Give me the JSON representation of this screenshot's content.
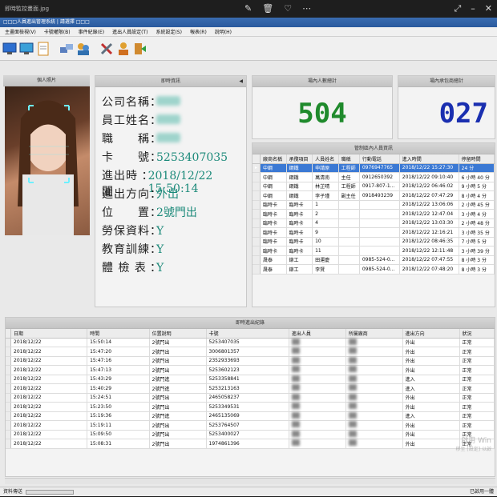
{
  "viewer": {
    "filename": "即時監控畫面.jpg",
    "icons": [
      "edit-icon",
      "trash-icon",
      "heart-icon",
      "more-icon"
    ],
    "right_icons": [
      "expand-icon",
      "minimize-icon",
      "close-icon"
    ]
  },
  "app": {
    "title": "□□□人員進出管理系統 | 請選擇 □□□ ",
    "menu": [
      "主畫面檢視(V)",
      "卡號權限(B)",
      "事件紀錄(E)",
      "進出人員設定(T)",
      "系統設定(S)",
      "報表(R)",
      "說明(H)"
    ]
  },
  "toolbar": {
    "buttons": [
      "monitor-icon",
      "monitor-icon",
      "document-icon",
      "network-icon",
      "users-icon",
      "tools-icon",
      "user-settings-icon",
      "exit-icon"
    ]
  },
  "photo_panel": {
    "title": "個人照片"
  },
  "info_panel": {
    "title": "即時資訊",
    "rows": [
      {
        "label": "公司名稱",
        "value": ""
      },
      {
        "label": "員工姓名",
        "value": ""
      },
      {
        "label": "職　　稱",
        "value": ""
      },
      {
        "label": "卡　　號",
        "value": "5253407035"
      },
      {
        "label": "進出時間",
        "value": "2018/12/22 15:50:14"
      },
      {
        "label": "進出方向",
        "value": "外出"
      },
      {
        "label": "位　　置",
        "value": "2號門出"
      },
      {
        "label": "勞保資料",
        "value": "Y"
      },
      {
        "label": "教育訓練",
        "value": "Y"
      },
      {
        "label": "體 檢 表",
        "value": "Y"
      }
    ]
  },
  "stat_left": {
    "title": "場內人數總計",
    "value": "504",
    "color": "#1f8a2c"
  },
  "stat_right": {
    "title": "場內承包商總計",
    "value": "027",
    "color": "#1a2fb0"
  },
  "present_panel": {
    "title": "管制區內人員資訊",
    "columns": [
      "廠商名稱",
      "承攬項目",
      "人員姓名",
      "職稱",
      "行動電話",
      "進入時間",
      "停留時間"
    ],
    "rows": [
      [
        "中鋼",
        "鋼鐵",
        "申請原",
        "工程師",
        "0976947765",
        "2018/12/22 15:27:30",
        "24 分"
      ],
      [
        "中鋼",
        "鋼鐵",
        "萬清南",
        "主任",
        "0912650392",
        "2018/12/22 09:10:40",
        "6 小時 40 分"
      ],
      [
        "中鋼",
        "鋼鐵",
        "林芷晴",
        "工程師",
        "0917-807-1...",
        "2018/12/22 06:46:02",
        "9 小時 5 分"
      ],
      [
        "中鋼",
        "鋼鐵",
        "李子瑾",
        "副主任",
        "0918493239",
        "2018/12/22 07:47:29",
        "8 小時 4 分"
      ],
      [
        "臨時卡",
        "臨時卡",
        "1",
        "",
        "",
        "2018/12/22 13:06:06",
        "2 小時 45 分"
      ],
      [
        "臨時卡",
        "臨時卡",
        "2",
        "",
        "",
        "2018/12/22 12:47:04",
        "3 小時 4 分"
      ],
      [
        "臨時卡",
        "臨時卡",
        "4",
        "",
        "",
        "2018/12/22 13:03:30",
        "2 小時 48 分"
      ],
      [
        "臨時卡",
        "臨時卡",
        "9",
        "",
        "",
        "2018/12/22 12:16:21",
        "3 小時 35 分"
      ],
      [
        "臨時卡",
        "臨時卡",
        "10",
        "",
        "",
        "2018/12/22 08:46:35",
        "7 小時 5 分"
      ],
      [
        "臨時卡",
        "臨時卡",
        "11",
        "",
        "",
        "2018/12/22 12:11:48",
        "3 小時 39 分"
      ],
      [
        "晟泰",
        "鉚工",
        "田運慶",
        "",
        "0985-524-0...",
        "2018/12/22 07:47:55",
        "8 小時 3 分"
      ],
      [
        "晟泰",
        "鉚工",
        "李賢",
        "",
        "0985-524-0...",
        "2018/12/22 07:48:20",
        "8 小時 3 分"
      ]
    ]
  },
  "log_panel": {
    "title": "即時進出紀錄",
    "columns": [
      "日期",
      "時間",
      "位置說明",
      "卡號",
      "進出人員",
      "所屬廠商",
      "進出方向",
      "狀況"
    ],
    "rows": [
      [
        "2018/12/22",
        "15:50:14",
        "2號門出",
        "5253407035",
        "",
        "",
        "外出",
        "正常"
      ],
      [
        "2018/12/22",
        "15:47:20",
        "2號門出",
        "3006801357",
        "",
        "",
        "外出",
        "正常"
      ],
      [
        "2018/12/22",
        "15:47:16",
        "2號門出",
        "2352933693",
        "",
        "",
        "外出",
        "正常"
      ],
      [
        "2018/12/22",
        "15:47:13",
        "2號門出",
        "5253602123",
        "",
        "",
        "外出",
        "正常"
      ],
      [
        "2018/12/22",
        "15:43:29",
        "2號門進",
        "5253358841",
        "",
        "",
        "進入",
        "正常"
      ],
      [
        "2018/12/22",
        "15:40:29",
        "2號門進",
        "5253213163",
        "",
        "",
        "進入",
        "正常"
      ],
      [
        "2018/12/22",
        "15:24:51",
        "2號門出",
        "2465058237",
        "",
        "",
        "外出",
        "正常"
      ],
      [
        "2018/12/22",
        "15:23:50",
        "2號門出",
        "5253349531",
        "",
        "",
        "外出",
        "正常"
      ],
      [
        "2018/12/22",
        "15:19:36",
        "2號門進",
        "2465135069",
        "",
        "",
        "進入",
        "正常"
      ],
      [
        "2018/12/22",
        "15:19:11",
        "2號門出",
        "5253764507",
        "",
        "",
        "外出",
        "正常"
      ],
      [
        "2018/12/22",
        "15:09:50",
        "2號門出",
        "5253400027",
        "",
        "",
        "外出",
        "正常"
      ],
      [
        "2018/12/22",
        "15:08:31",
        "2號門出",
        "1974861396",
        "",
        "",
        "外出",
        "正常"
      ]
    ]
  },
  "status": {
    "left": "資料傳送",
    "right": "已啟用一體"
  },
  "watermark": {
    "line1": "啟用 Win",
    "line2": "移至 [設定] 以啟"
  }
}
